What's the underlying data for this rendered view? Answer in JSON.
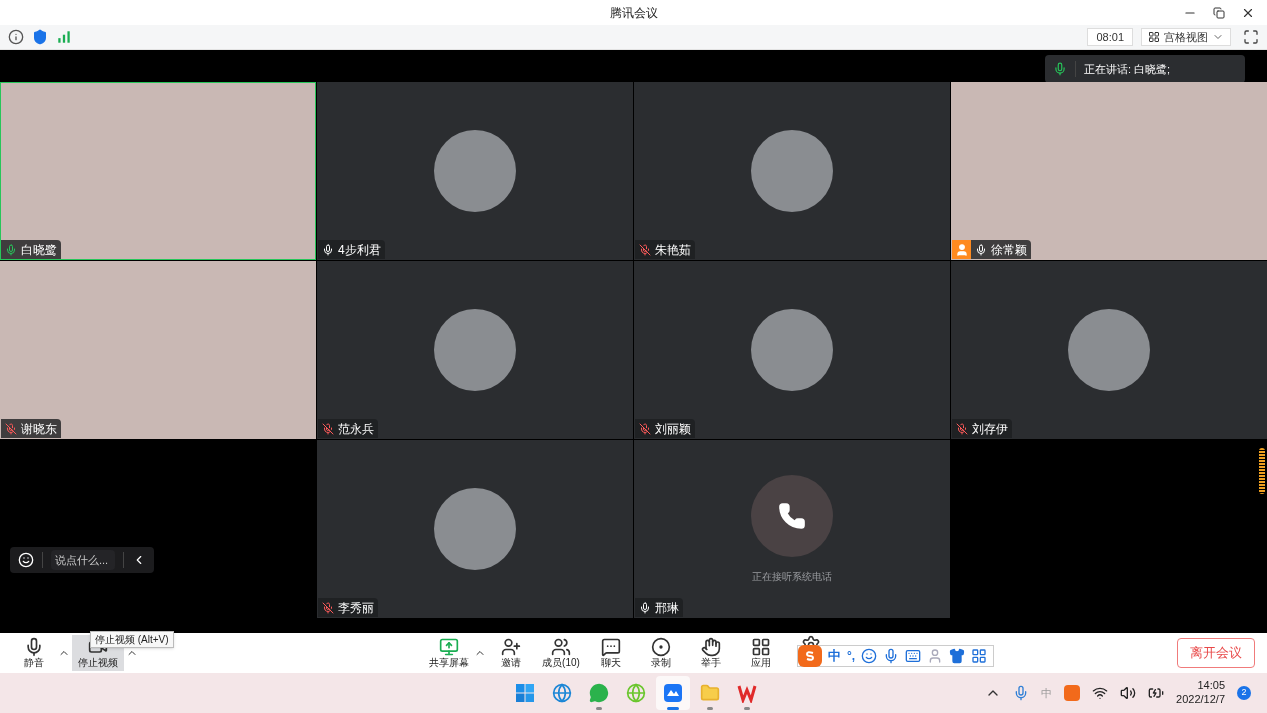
{
  "window": {
    "title": "腾讯会议"
  },
  "top_bar": {
    "timer": "08:01",
    "view_button": "宫格视图"
  },
  "speaking_indicator": {
    "text": "正在讲话: 白晓鹭;"
  },
  "tiles": [
    {
      "kind": "video",
      "name": "白晓鹭",
      "muted": false,
      "speaking": true,
      "host": false
    },
    {
      "kind": "avatar",
      "name": "4步利君",
      "muted": false,
      "speaking": false,
      "host": false
    },
    {
      "kind": "avatar",
      "name": "朱艳茹",
      "muted": true,
      "speaking": false,
      "host": false
    },
    {
      "kind": "video",
      "name": "徐常颖",
      "muted": false,
      "speaking": false,
      "host": true
    },
    {
      "kind": "video",
      "name": "谢晓东",
      "muted": true,
      "speaking": false,
      "host": false
    },
    {
      "kind": "avatar",
      "name": "范永兵",
      "muted": true,
      "speaking": false,
      "host": false
    },
    {
      "kind": "avatar",
      "name": "刘丽颖",
      "muted": true,
      "speaking": false,
      "host": false
    },
    {
      "kind": "avatar",
      "name": "刘存伊",
      "muted": true,
      "speaking": false,
      "host": false
    },
    {
      "kind": "empty"
    },
    {
      "kind": "avatar",
      "name": "李秀丽",
      "muted": true,
      "speaking": false,
      "host": false
    },
    {
      "kind": "phone",
      "name": "邢琳",
      "muted": false,
      "speaking": false,
      "host": false,
      "status": "正在接听系统电话"
    },
    {
      "kind": "empty"
    }
  ],
  "chat_box": {
    "placeholder": "说点什么..."
  },
  "toolbar": {
    "left": [
      {
        "kind": "mic",
        "label": "静音",
        "selected": false
      },
      {
        "kind": "video",
        "label": "停止视频",
        "selected": true
      }
    ],
    "tooltip": "停止视频 (Alt+V)",
    "center": [
      {
        "kind": "share",
        "label": "共享屏幕",
        "caret": true
      },
      {
        "kind": "invite",
        "label": "邀请",
        "caret": false
      },
      {
        "kind": "members",
        "label": "成员(10)",
        "caret": false
      },
      {
        "kind": "chat",
        "label": "聊天",
        "caret": false
      },
      {
        "kind": "record",
        "label": "录制",
        "caret": false
      },
      {
        "kind": "hand",
        "label": "举手",
        "caret": false
      },
      {
        "kind": "apps",
        "label": "应用",
        "caret": false
      },
      {
        "kind": "settings"
      }
    ],
    "leave_button": "离开会议"
  },
  "ime_bar": {
    "mode": "中",
    "punctuation": "°,"
  },
  "taskbar": {
    "apps": [
      {
        "kind": "start",
        "selected": false,
        "running": false
      },
      {
        "kind": "browser",
        "selected": false,
        "running": false
      },
      {
        "kind": "chat",
        "selected": false,
        "running": true
      },
      {
        "kind": "ie",
        "selected": false,
        "running": false
      },
      {
        "kind": "meeting",
        "selected": true,
        "running": true
      },
      {
        "kind": "folder",
        "selected": false,
        "running": true
      },
      {
        "kind": "office",
        "selected": false,
        "running": true
      }
    ],
    "ime": "中",
    "time": "14:05",
    "date": "2022/12/7",
    "notifications": "2"
  }
}
